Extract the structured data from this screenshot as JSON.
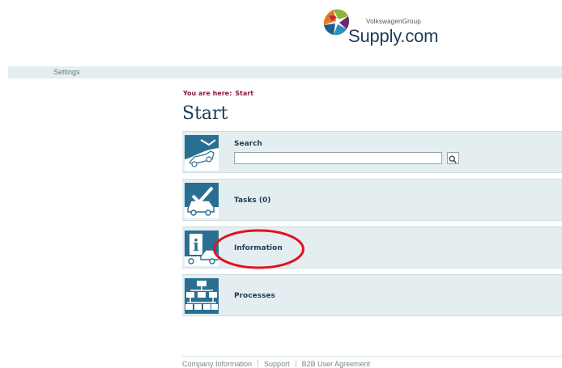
{
  "logo": {
    "small_text": "VolkswagenGroup",
    "big_text": "Supply.com"
  },
  "settings_bar": {
    "link": "Settings"
  },
  "breadcrumb": {
    "prefix": "You are here:",
    "current": "Start"
  },
  "page_title": "Start",
  "tiles": {
    "search": {
      "label": "Search",
      "input_value": "",
      "icon": "search-car-icon"
    },
    "tasks": {
      "label": "Tasks (0)",
      "icon": "tasks-checkmark-icon"
    },
    "information": {
      "label": "Information",
      "icon": "information-icon"
    },
    "processes": {
      "label": "Processes",
      "icon": "processes-tree-icon"
    }
  },
  "annotation": {
    "color": "#e0141e"
  },
  "colors": {
    "tile_bg": "#e4eef0",
    "icon_blue": "#2a6f92",
    "title_navy": "#1d3c58",
    "breadcrumb": "#8c1a3a"
  },
  "footer": {
    "links": [
      "Company Information",
      "Support",
      "B2B User Agreement"
    ]
  }
}
